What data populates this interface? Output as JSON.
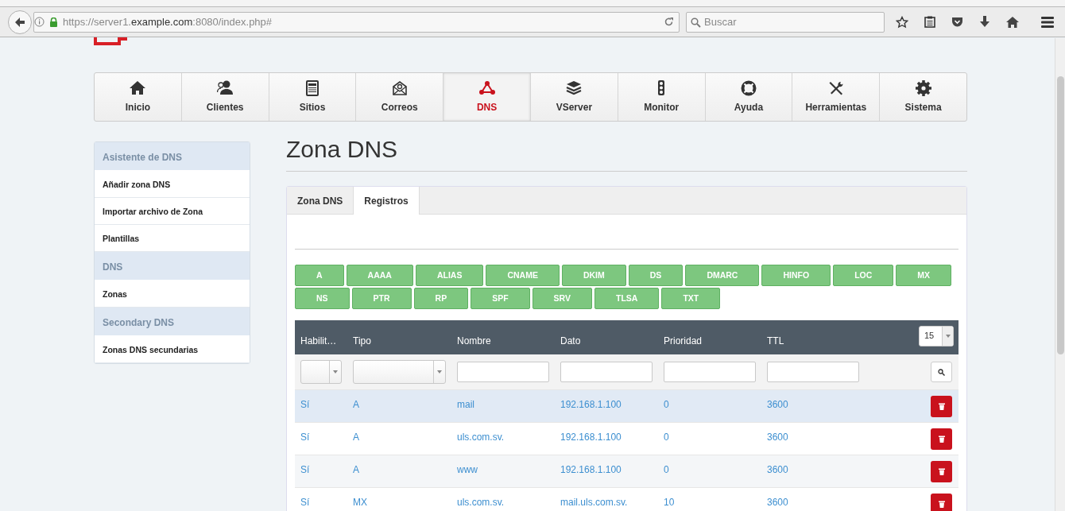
{
  "browser": {
    "url_host_prefix": "https://server1.",
    "url_domain": "example.com",
    "url_rest": ":8080/index.php#",
    "search_placeholder": "Buscar"
  },
  "nav": [
    {
      "label": "Inicio",
      "selected": false
    },
    {
      "label": "Clientes",
      "selected": false
    },
    {
      "label": "Sitios",
      "selected": false
    },
    {
      "label": "Correos",
      "selected": false
    },
    {
      "label": "DNS",
      "selected": true
    },
    {
      "label": "VServer",
      "selected": false
    },
    {
      "label": "Monitor",
      "selected": false
    },
    {
      "label": "Ayuda",
      "selected": false
    },
    {
      "label": "Herramientas",
      "selected": false
    },
    {
      "label": "Sistema",
      "selected": false
    }
  ],
  "sidebar": [
    {
      "title": "Asistente de DNS",
      "items": [
        {
          "label": "Añadir zona DNS"
        },
        {
          "label": "Importar archivo de Zona"
        },
        {
          "label": "Plantillas"
        }
      ]
    },
    {
      "title": "DNS",
      "items": [
        {
          "label": "Zonas"
        }
      ]
    },
    {
      "title": "Secondary DNS",
      "items": [
        {
          "label": "Zonas DNS secundarias"
        }
      ]
    }
  ],
  "page_title": "Zona DNS",
  "tabs": [
    {
      "label": "Zona DNS",
      "selected": false
    },
    {
      "label": "Registros",
      "selected": true
    }
  ],
  "record_buttons": [
    "A",
    "AAAA",
    "ALIAS",
    "CNAME",
    "DKIM",
    "DS",
    "DMARC",
    "HINFO",
    "LOC",
    "MX",
    "NS",
    "PTR",
    "RP",
    "SPF",
    "SRV",
    "TLSA",
    "TXT"
  ],
  "table": {
    "columns": [
      {
        "label": "Habilit…",
        "kind": "select"
      },
      {
        "label": "Tipo",
        "kind": "select"
      },
      {
        "label": "Nombre",
        "kind": "text"
      },
      {
        "label": "Dato",
        "kind": "text"
      },
      {
        "label": "Prioridad",
        "kind": "text"
      },
      {
        "label": "TTL",
        "kind": "text"
      }
    ],
    "page_size": "15",
    "rows": [
      {
        "cells": [
          "Sí",
          "A",
          "mail",
          "192.168.1.100",
          "0",
          "3600"
        ],
        "highlighted": true
      },
      {
        "cells": [
          "Sí",
          "A",
          "uls.com.sv.",
          "192.168.1.100",
          "0",
          "3600"
        ],
        "highlighted": false
      },
      {
        "cells": [
          "Sí",
          "A",
          "www",
          "192.168.1.100",
          "0",
          "3600"
        ],
        "highlighted": false
      },
      {
        "cells": [
          "Sí",
          "MX",
          "uls.com.sv.",
          "mail.uls.com.sv.",
          "10",
          "3600"
        ],
        "highlighted": false
      }
    ]
  }
}
